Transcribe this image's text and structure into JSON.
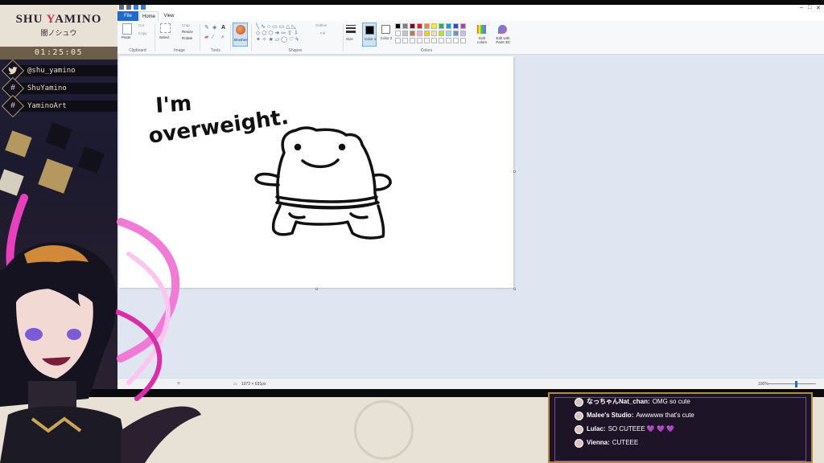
{
  "overlay": {
    "brand_name_pre": "SHU ",
    "brand_name_accent": "Y",
    "brand_name_post": "AMINO",
    "brand_jp": "闇ノシュウ",
    "timer": "01:25:05",
    "socials": [
      {
        "icon": "twitter-icon",
        "glyph": "🐦",
        "text": "@shu_yamino"
      },
      {
        "icon": "hashtag-icon",
        "glyph": "#",
        "text": "ShuYamino"
      },
      {
        "icon": "hashtag-icon",
        "glyph": "#",
        "text": "YaminoArt"
      }
    ]
  },
  "paint": {
    "tabs": {
      "file": "File",
      "home": "Home",
      "view": "View"
    },
    "ribbon": {
      "clipboard": {
        "paste": "Paste",
        "cut": "Cut",
        "copy": "Copy",
        "label": "Clipboard"
      },
      "image": {
        "select": "Select",
        "crop": "Crop",
        "resize": "Resize",
        "rotate": "Rotate",
        "label": "Image"
      },
      "tools": {
        "label": "Tools"
      },
      "brushes": {
        "label": "Brushes"
      },
      "shapes": {
        "outline": "Outline",
        "fill": "Fill",
        "label": "Shapes"
      },
      "size": {
        "label": "Size"
      },
      "color1": {
        "label": "Color 1"
      },
      "color2": {
        "label": "Color 2"
      },
      "colors": {
        "label": "Colors",
        "edit": "Edit colors",
        "paint3d": "Edit with Paint 3D"
      }
    },
    "palette": {
      "row1": [
        "#000000",
        "#7f7f7f",
        "#880015",
        "#ed1c24",
        "#ff7f27",
        "#fff200",
        "#22b14c",
        "#00a2e8",
        "#3f48cc",
        "#a349a4"
      ],
      "row2": [
        "#ffffff",
        "#c3c3c3",
        "#b97a57",
        "#ffaec9",
        "#ffc90e",
        "#efe4b0",
        "#b5e61d",
        "#99d9ea",
        "#7092be",
        "#c8bfe7"
      ],
      "row3": [
        "#ffffff",
        "#ffffff",
        "#ffffff",
        "#ffffff",
        "#ffffff",
        "#ffffff",
        "#ffffff",
        "#ffffff",
        "#ffffff",
        "#ffffff"
      ]
    },
    "canvas_text_line1": "I'm",
    "canvas_text_line2": "overweight.",
    "status": {
      "dimensions": "1072 × 631px",
      "zoom": "100%"
    }
  },
  "chat": {
    "messages": [
      {
        "name": "なっちゃんNat_chan:",
        "message": "OMG so cute",
        "hearts": ""
      },
      {
        "name": "Malee's Studio:",
        "message": "Awwwww that's cute",
        "hearts": ""
      },
      {
        "name": "Lulac:",
        "message": "SO CUTEEE",
        "hearts": "💜 💜 💜"
      },
      {
        "name": "Vienna:",
        "message": "CUTEEE",
        "hearts": ""
      }
    ]
  }
}
